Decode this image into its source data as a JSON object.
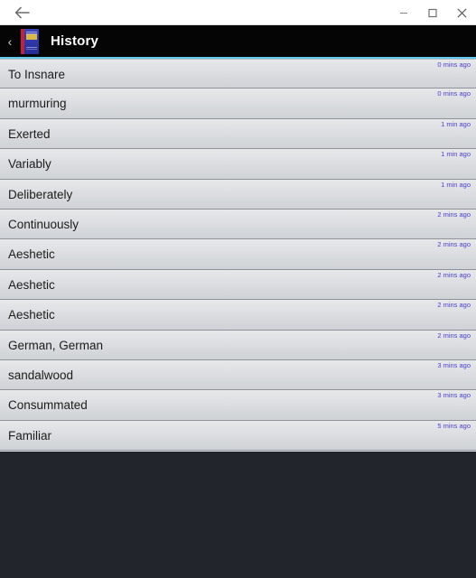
{
  "window": {
    "back_icon": "back-arrow-icon",
    "controls": [
      {
        "name": "minimize-button",
        "icon": "minimize-icon",
        "label": "Minimize"
      },
      {
        "name": "maximize-button",
        "icon": "maximize-icon",
        "label": "Maximize"
      },
      {
        "name": "close-button",
        "icon": "close-icon",
        "label": "Close"
      }
    ]
  },
  "appbar": {
    "back_chevron": "‹",
    "app_icon": "dictionary-book-icon",
    "title": "History",
    "background_color": "#050505",
    "accent_color": "#5ec8ee"
  },
  "list": {
    "items": [
      {
        "title": "To Insnare",
        "time": "0 mins ago"
      },
      {
        "title": "murmuring",
        "time": "0 mins ago"
      },
      {
        "title": "Exerted",
        "time": "1 min ago"
      },
      {
        "title": "Variably",
        "time": "1 min ago"
      },
      {
        "title": "Deliberately",
        "time": "1 min ago"
      },
      {
        "title": "Continuously",
        "time": "2 mins ago"
      },
      {
        "title": "Aeshetic",
        "time": "2 mins ago"
      },
      {
        "title": "Aeshetic",
        "time": "2 mins ago"
      },
      {
        "title": "Aeshetic",
        "time": "2 mins ago"
      },
      {
        "title": "German, German",
        "time": "2 mins ago"
      },
      {
        "title": "sandalwood",
        "time": "3 mins ago"
      },
      {
        "title": "Consummated",
        "time": "3 mins ago"
      },
      {
        "title": "Familiar",
        "time": "5 mins ago"
      }
    ],
    "time_color": "#4a3fd6",
    "title_color": "#1c1c1c"
  },
  "footer": {
    "background_color": "#22262c"
  }
}
